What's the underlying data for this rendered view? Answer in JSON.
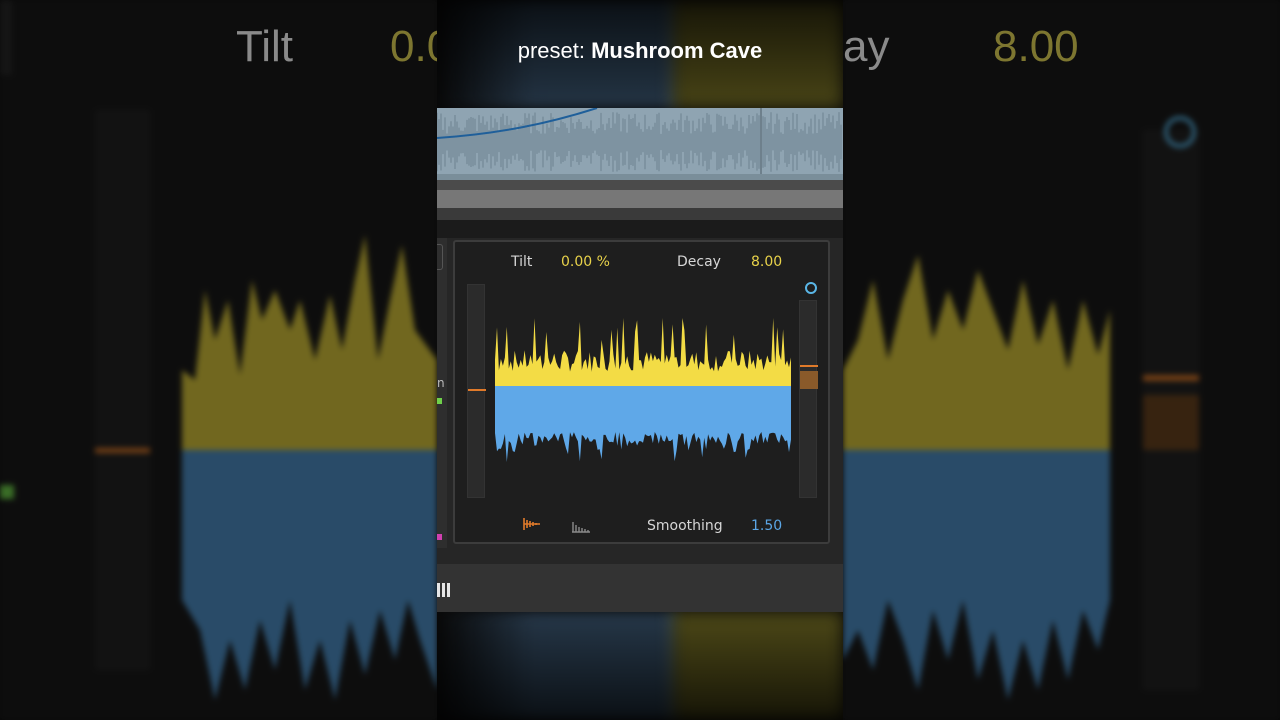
{
  "overlay": {
    "preset_prefix": "preset: ",
    "preset_name": "Mushroom Cave"
  },
  "background": {
    "left_label": "Tilt",
    "left_value": "0.0",
    "right_label": "ay",
    "right_value": "8.00"
  },
  "device": {
    "tilt_label": "Tilt",
    "tilt_value": "0.00 %",
    "decay_label": "Decay",
    "decay_value": "8.00",
    "smoothing_label": "Smoothing",
    "smoothing_value": "1.50",
    "mode_icons": [
      "impulse-decay-icon",
      "spectrum-bars-icon"
    ],
    "left_edge_fragment": "n"
  },
  "colors": {
    "value_yellow": "#e8d24a",
    "value_blue": "#5ba6e6",
    "wave_top": "#f3dc45",
    "wave_bottom": "#5fa8e8",
    "accent_orange": "#e07a2a"
  }
}
